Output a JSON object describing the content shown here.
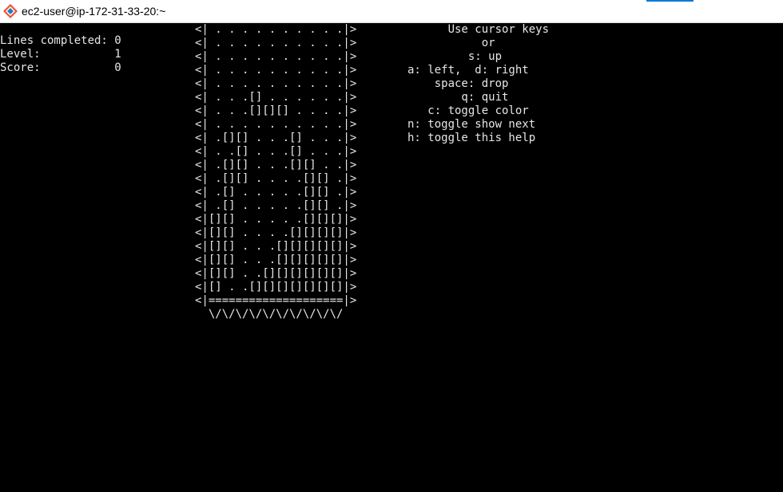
{
  "window": {
    "title": "ec2-user@ip-172-31-33-20:~",
    "icon": "git-bash-icon"
  },
  "stats": [
    "Lines completed: 0",
    "Level:           1",
    "Score:           0"
  ],
  "board_rows": [
    "<| . . . . . . . . . .|>",
    "<| . . . . . . . . . .|>",
    "<| . . . . . . . . . .|>",
    "<| . . . . . . . . . .|>",
    "<| . . . . . . . . . .|>",
    "<| . . .[] . . . . . .|>",
    "<| . . .[][][] . . . .|>",
    "<| . . . . . . . . . .|>",
    "<| .[][] . . .[] . . .|>",
    "<| . .[] . . .[] . . .|>",
    "<| .[][] . . .[][] . .|>",
    "<| .[][] . . . .[][] .|>",
    "<| .[] . . . . .[][] .|>",
    "<| .[] . . . . .[][] .|>",
    "<|[][] . . . . .[][][]|>",
    "<|[][] . . . .[][][][]|>",
    "<|[][] . . .[][][][][]|>",
    "<|[][] . . .[][][][][]|>",
    "<|[][] . .[][][][][][]|>",
    "<|[] . .[][][][][][][]|>",
    "<|====================|>",
    "  \\/\\/\\/\\/\\/\\/\\/\\/\\/\\/"
  ],
  "help": [
    "      Use cursor keys",
    "           or",
    "         s: up",
    "a: left,  d: right",
    "    space: drop",
    "        q: quit",
    "   c: toggle color",
    "n: toggle show next",
    "h: toggle this help"
  ]
}
